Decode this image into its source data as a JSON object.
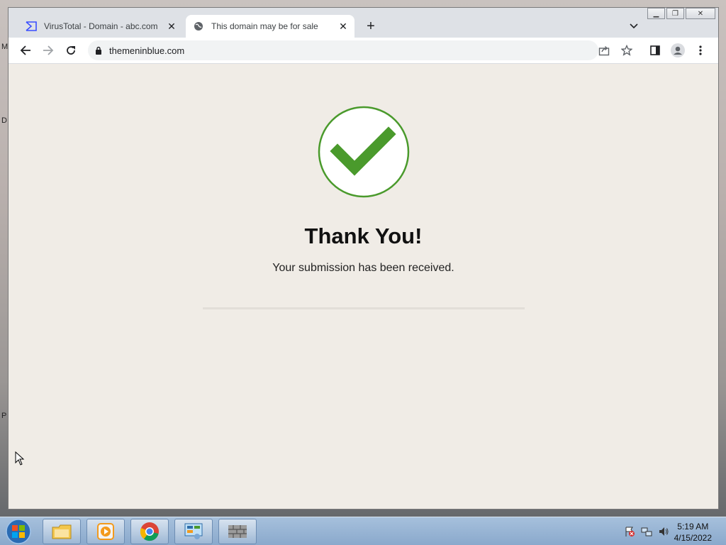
{
  "desktop": {
    "edge_letters": [
      "M",
      "D",
      "P"
    ]
  },
  "browser": {
    "tabs": [
      {
        "title": "VirusTotal - Domain - abc.com",
        "favicon": "virustotal-icon",
        "active": false
      },
      {
        "title": "This domain may be for sale",
        "favicon": "globe-icon",
        "active": true
      }
    ],
    "url": "themeninblue.com"
  },
  "page": {
    "icon": "checkmark-circle-icon",
    "heading": "Thank You!",
    "subtext": "Your submission has been received.",
    "accent_color": "#4a9a2c"
  },
  "taskbar": {
    "apps": [
      "file-explorer-icon",
      "media-player-icon",
      "chrome-icon",
      "control-panel-icon",
      "firewall-icon"
    ],
    "clock": {
      "time": "5:19 AM",
      "date": "4/15/2022"
    }
  }
}
